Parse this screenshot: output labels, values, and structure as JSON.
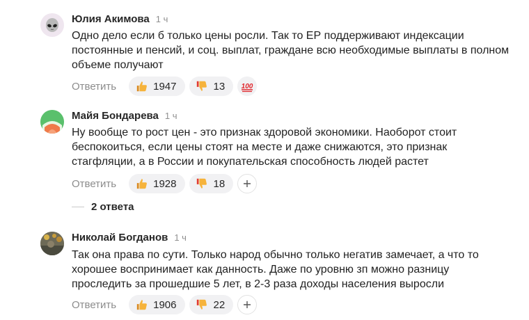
{
  "comments": [
    {
      "author": "Юлия Акимова",
      "time": "1 ч",
      "avatar_icon": "alien-avatar",
      "text_lines": [
        "Одно дело если б только цены росли. Так то ЕР поддерживают индексации",
        "постоянные и пенсий, и соц. выплат, граждане всю необходимые выплаты в полном",
        "объеме получают"
      ],
      "reply_label": "Ответить",
      "likes": "1947",
      "dislikes": "13",
      "extra_reaction_icon": "hundred-points-icon",
      "extra_reaction_text": "100"
    },
    {
      "author": "Майя Бондарева",
      "time": "1 ч",
      "avatar_icon": "lime-slice-avatar",
      "text_lines": [
        "Ну вообще то рост цен - это признак здоровой экономики. Наоборот стоит",
        "беспокоиться, если цены стоят на месте и даже снижаются, это признак",
        "стагфляции, а в России и покупательская способность людей растет"
      ],
      "reply_label": "Ответить",
      "likes": "1928",
      "dislikes": "18",
      "replies_label": "2 ответа"
    },
    {
      "author": "Николай Богданов",
      "time": "1 ч",
      "avatar_icon": "photo-avatar",
      "text_lines": [
        "Так она права по сути. Только народ обычно только негатив замечает, а что то",
        "хорошее воспринимает как данность. Даже по уровню зп можно разницу",
        "проследить за прошедшие 5 лет, в 2-3 раза доходы населения выросли"
      ],
      "reply_label": "Ответить",
      "likes": "1906",
      "dislikes": "22"
    }
  ],
  "colors": {
    "pill_background": "#f1f1f3",
    "muted_text": "#8c8c8c",
    "thumb_yellow": "#f6b33b",
    "thumb_red": "#e23b2e"
  }
}
